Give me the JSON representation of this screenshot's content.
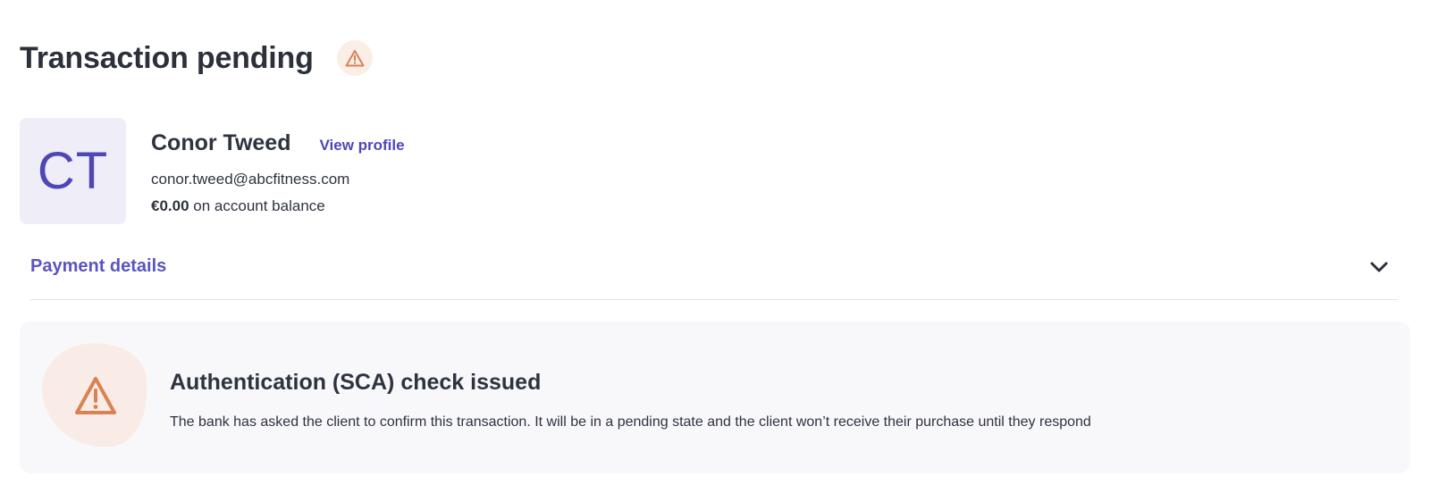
{
  "header": {
    "title": "Transaction pending",
    "status_icon": "warning-triangle-icon"
  },
  "client": {
    "initials": "CT",
    "name": "Conor Tweed",
    "view_profile_label": "View profile",
    "email": "conor.tweed@abcfitness.com",
    "balance_amount": "€0.00",
    "balance_suffix": "on account balance"
  },
  "payment_details": {
    "label": "Payment details",
    "toggle_icon": "chevron-down-icon"
  },
  "alert": {
    "icon": "warning-triangle-icon",
    "title": "Authentication (SCA) check issued",
    "message": "The bank has asked the client to confirm this transaction. It will be in a pending state and the client won’t receive their purchase until they respond"
  },
  "colors": {
    "accent": "#4f47b8",
    "warning": "#d98253",
    "warning_bg": "#fbeee7",
    "avatar_bg": "#eeedf8",
    "alert_bg": "#f8f8fb",
    "text": "#2e3340"
  }
}
